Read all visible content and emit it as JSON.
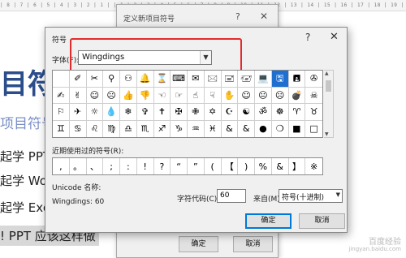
{
  "ruler_text": "| 8 | 7 | 6 | 5 | 4 | 3 | 2 | 1 | | 1 | 2 | 3 | 4 | 5 | 6 | 7 | 8 | 9 | 10 | 11 | 12 | 13 | 14 | 15 | 16 | 17 | 18 | 19 | 20 | 21 | 22 | 23 | 24 | 25 | 26 | 27 | 28 | 29 | 30 | 31 | 32 | 33 | 34 | 35 | 36 | 37 | 38 |",
  "document": {
    "title": "目符号",
    "subtitle": "项目符号",
    "lines": [
      "起学 PPT",
      "起学 Wo",
      "起学 Exc",
      "! PPT 应该这样做"
    ]
  },
  "back_dialog": {
    "title": "定义新项目符号",
    "help": "?",
    "close": "✕",
    "ok": "确定",
    "cancel": "取消"
  },
  "dialog": {
    "title": "符号",
    "help": "?",
    "close": "✕",
    "font_label": "字体(F):",
    "font_value": "Wingdings",
    "grid": [
      "",
      "✐",
      "✂",
      "⚲",
      "⚇",
      "🔔",
      "⌛",
      "⌨",
      "✉",
      "🖂",
      "🖃",
      "🖅",
      "💻",
      "🖫",
      "🖪",
      "✇",
      "✍",
      "✌",
      "☺",
      "☹",
      "👍",
      "👎",
      "☜",
      "☞",
      "☝",
      "☟",
      "✋",
      "☺",
      "😐",
      "☹",
      "💣",
      "☠",
      "⚐",
      "✈",
      "☼",
      "💧",
      "❄",
      "✞",
      "✝",
      "✠",
      "✙",
      "✡",
      "☪",
      "☯",
      "ॐ",
      "☸",
      "♈",
      "♉",
      "♊",
      "♋",
      "♌",
      "♍",
      "♎",
      "♏",
      "♐",
      "♑",
      "♒",
      "♓",
      "&",
      "&",
      "●",
      "❍",
      "■",
      "□"
    ],
    "selected_index": 13,
    "recent_label": "近期使用过的符号(R):",
    "recent": [
      ",",
      "。",
      "、",
      ";",
      ":",
      "!",
      "?",
      "“",
      "”",
      "(",
      "【",
      ")",
      "%",
      "&",
      "】",
      "※"
    ],
    "unicode_label": "Unicode 名称:",
    "font_info": "Wingdings: 60",
    "code_label": "字符代码(C):",
    "code_value": "60",
    "from_label": "来自(M):",
    "from_value": "符号(十进制)",
    "ok": "确定",
    "cancel": "取消"
  },
  "watermark": {
    "line1": "百度经验",
    "line2": "jingyan.baidu.com"
  }
}
